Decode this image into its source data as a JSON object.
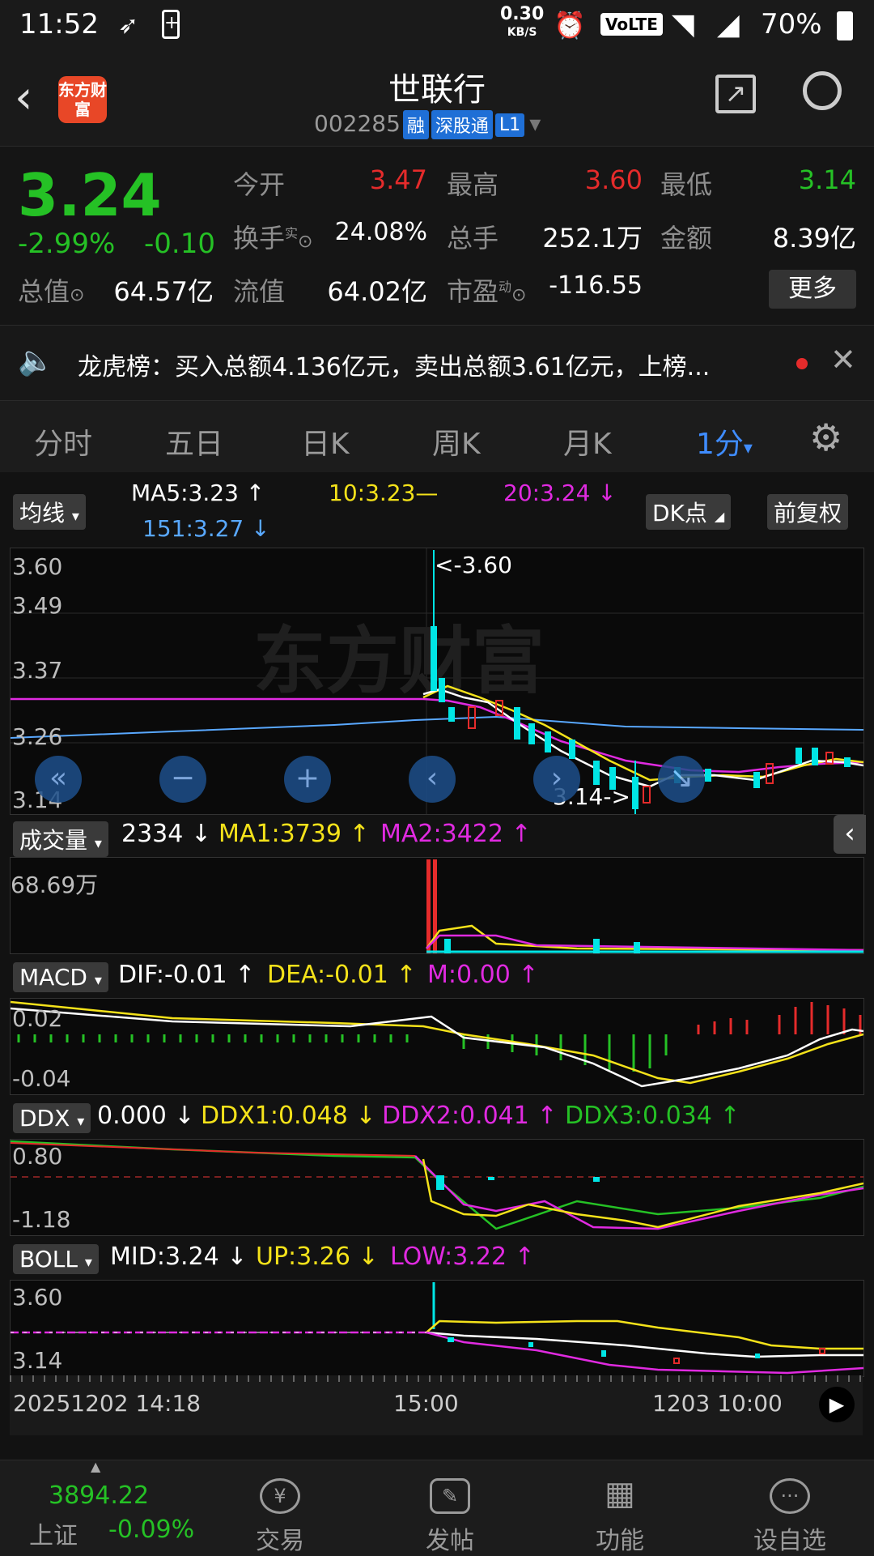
{
  "status": {
    "time": "11:52",
    "net_speed": "0.30",
    "net_unit": "KB/S",
    "volte": "VoLTE",
    "battery": "70%"
  },
  "header": {
    "title": "世联行",
    "code": "002285",
    "tags": [
      "融",
      "深股通",
      "L1"
    ],
    "logo_text": "东方财富"
  },
  "quote": {
    "price": "3.24",
    "pct": "-2.99%",
    "chg": "-0.10",
    "open_label": "今开",
    "open": "3.47",
    "high_label": "最高",
    "high": "3.60",
    "low_label": "最低",
    "low": "3.14",
    "turnover_label": "换手",
    "turnover_sup": "实",
    "turnover": "24.08%",
    "volume_label": "总手",
    "volume": "252.1万",
    "amount_label": "金额",
    "amount": "8.39亿",
    "mcap_label": "总值",
    "mcap": "64.57亿",
    "float_label": "流值",
    "float": "64.02亿",
    "pe_label": "市盈",
    "pe_sup": "动",
    "pe": "-116.55",
    "more": "更多"
  },
  "news": {
    "text": "龙虎榜：买入总额4.136亿元，卖出总额3.61亿元，上榜..."
  },
  "tabs": [
    "分时",
    "五日",
    "日K",
    "周K",
    "月K",
    "1分"
  ],
  "kline": {
    "ma_btn": "均线",
    "ma5": "MA5:3.23 ↑",
    "ma10": "10:3.23—",
    "ma20": "20:3.24 ↓",
    "ma151": "151:3.27 ↓",
    "dk_btn": "DK点",
    "fq_btn": "前复权",
    "y_labels": [
      "3.60",
      "3.49",
      "3.37",
      "3.26",
      "3.14"
    ],
    "high_mark": "<-3.60",
    "low_mark": "3.14->"
  },
  "volume": {
    "btn": "成交量",
    "val": "2334 ↓",
    "ma1": "MA1:3739 ↑",
    "ma2": "MA2:3422 ↑",
    "y": "68.69万"
  },
  "macd": {
    "btn": "MACD",
    "dif": "DIF:-0.01 ↑",
    "dea": "DEA:-0.01 ↑",
    "m": "M:0.00 ↑",
    "y_top": "0.02",
    "y_bot": "-0.04"
  },
  "ddx": {
    "btn": "DDX",
    "val": "0.000 ↓",
    "ddx1": "DDX1:0.048 ↓",
    "ddx2": "DDX2:0.041 ↑",
    "ddx3": "DDX3:0.034 ↑",
    "y_top": "0.80",
    "y_bot": "-1.18"
  },
  "boll": {
    "btn": "BOLL",
    "mid": "MID:3.24 ↓",
    "up": "UP:3.26 ↓",
    "low": "LOW:3.22 ↑",
    "y_top": "3.60",
    "y_bot": "3.14"
  },
  "xaxis": {
    "left": "20251202 14:18",
    "mid": "15:00",
    "right": "1203 10:00"
  },
  "bottom": {
    "index_val": "3894.22",
    "index_name": "上证",
    "index_pct": "-0.09%",
    "items": [
      "交易",
      "发帖",
      "功能",
      "设自选"
    ]
  }
}
